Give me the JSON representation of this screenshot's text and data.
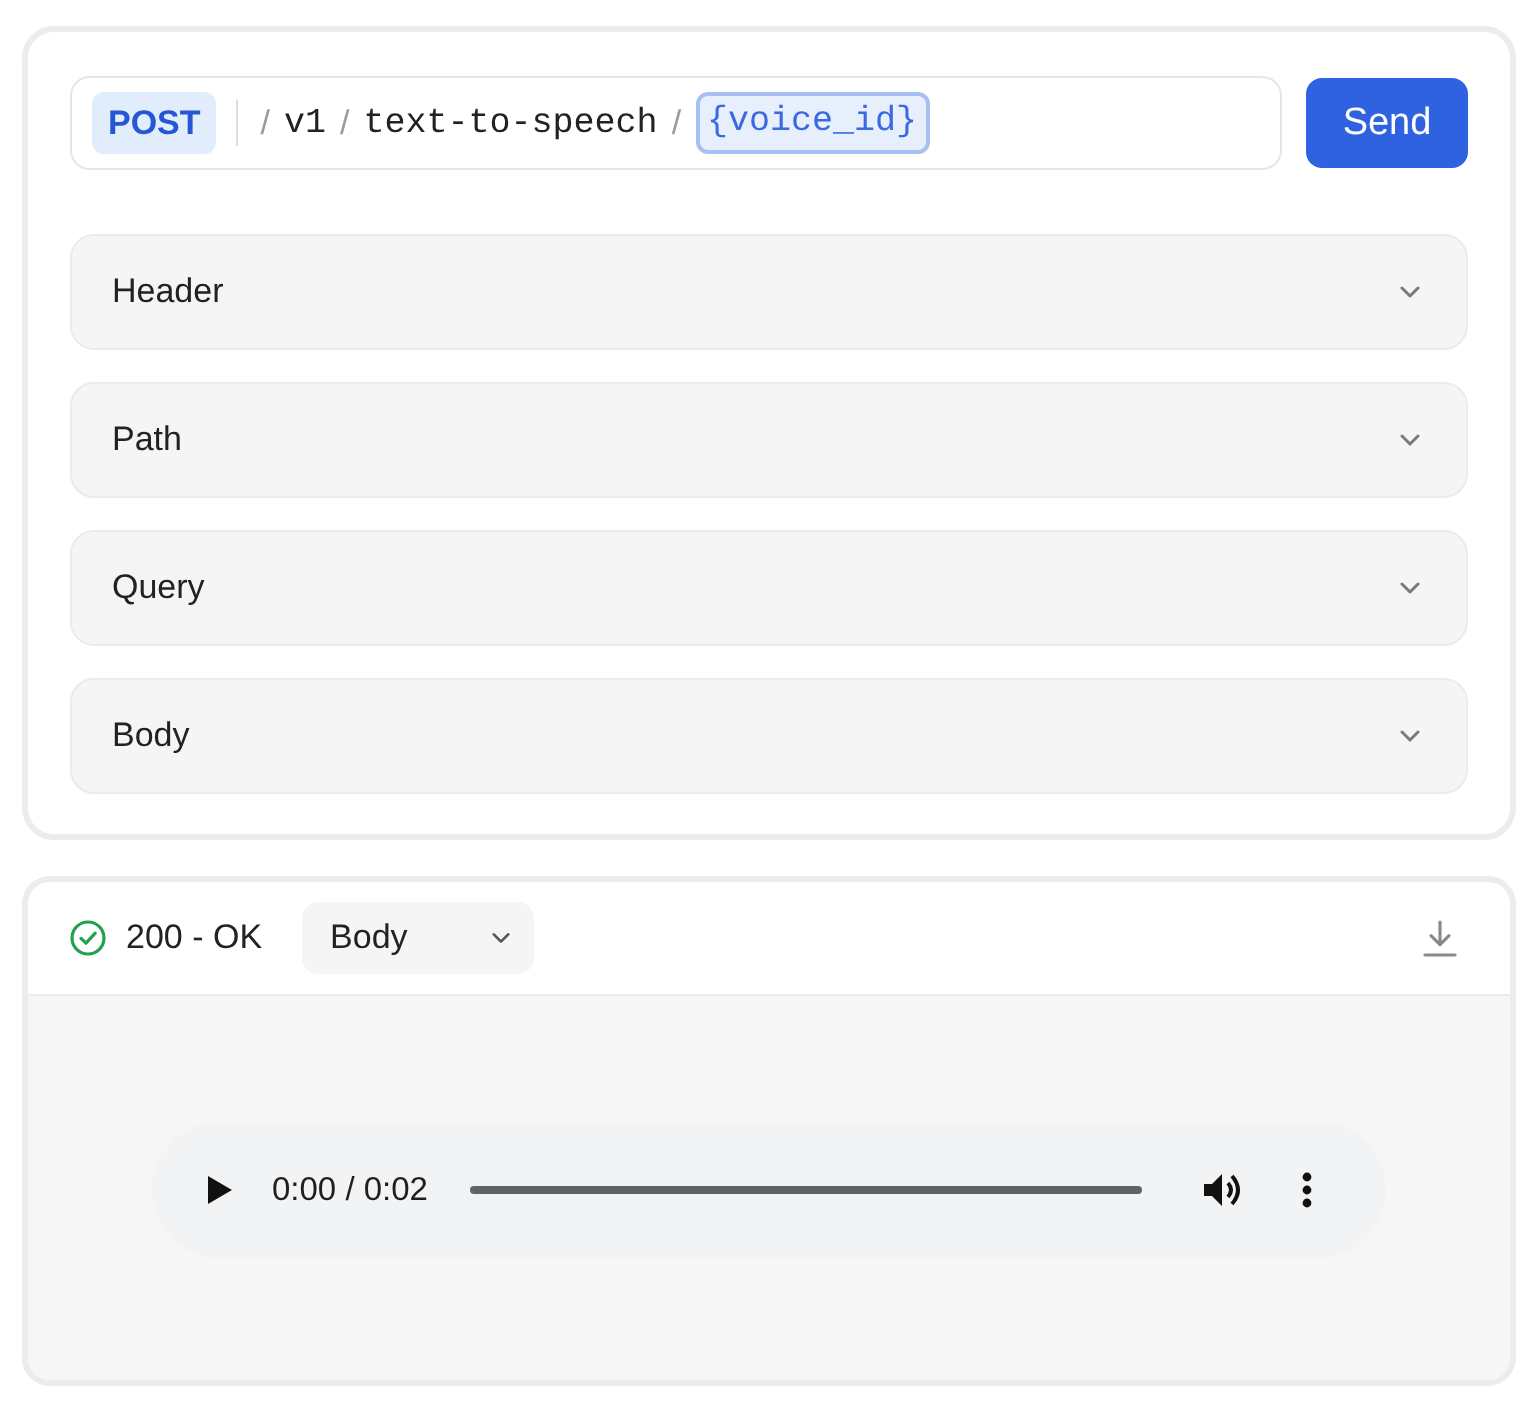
{
  "request": {
    "method": "POST",
    "path": [
      {
        "kind": "separator",
        "text": "/"
      },
      {
        "kind": "segment",
        "text": "v1"
      },
      {
        "kind": "separator",
        "text": "/"
      },
      {
        "kind": "segment",
        "text": "text-to-speech"
      },
      {
        "kind": "separator",
        "text": "/"
      },
      {
        "kind": "param",
        "text": "{voice_id}"
      }
    ],
    "send_button": "Send"
  },
  "sections": [
    {
      "label": "Header",
      "expanded": false
    },
    {
      "label": "Path",
      "expanded": false
    },
    {
      "label": "Query",
      "expanded": false
    },
    {
      "label": "Body",
      "expanded": false
    }
  ],
  "response": {
    "status": "200 - OK",
    "view_select": "Body",
    "audio": {
      "time": "0:00 / 0:02"
    }
  }
}
